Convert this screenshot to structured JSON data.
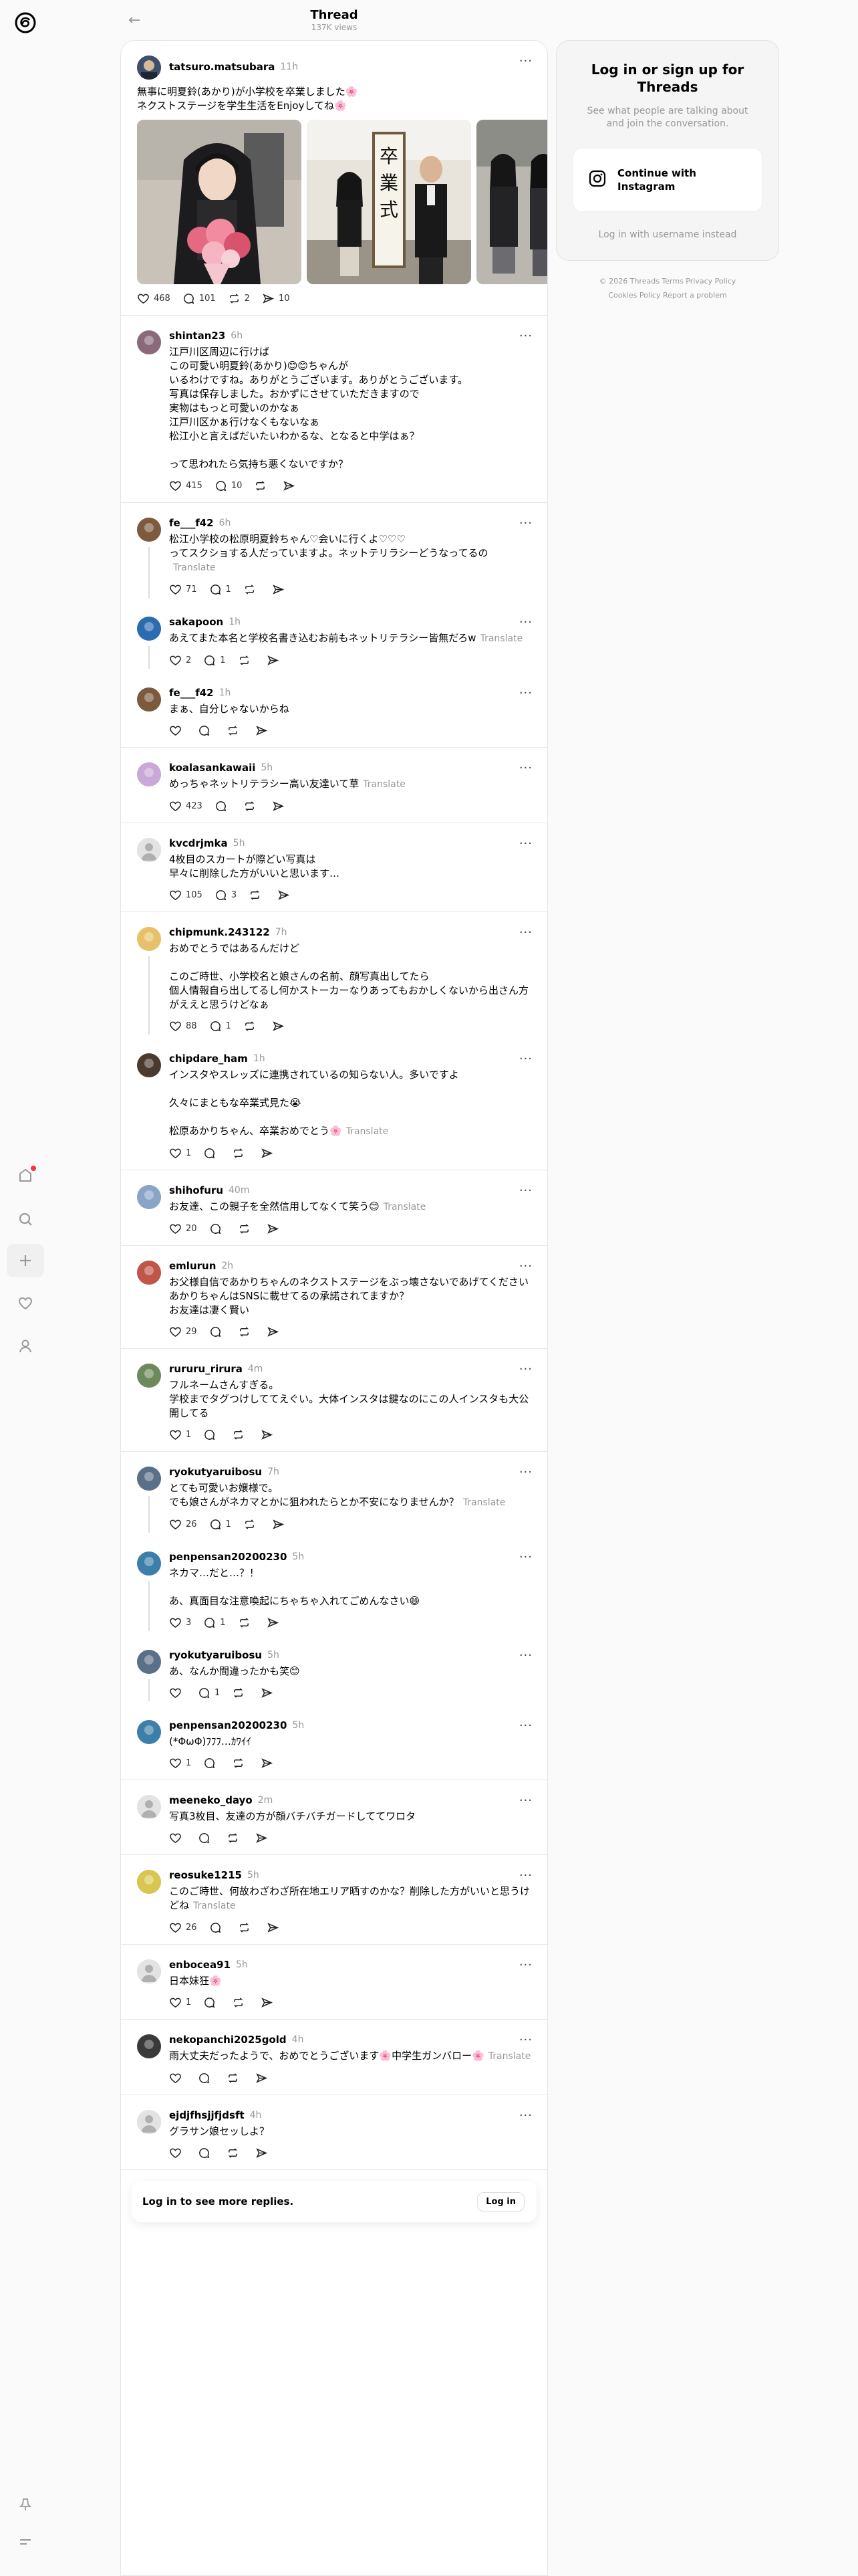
{
  "header": {
    "title": "Thread",
    "views": "137K views",
    "back_icon": "arrow-left-icon"
  },
  "main_post": {
    "username": "tatsuro.matsubara",
    "time": "11h",
    "text": "無事に明夏鈴(あかり)が小学校を卒業しました🌸\nネクストステージを学生生活をEnjoyしてね🌸",
    "likes": "468",
    "replies": "101",
    "reposts": "2",
    "shares": "10",
    "photos": [
      "graduation-photo-bouquet",
      "graduation-photo-sign",
      "graduation-photo-girls"
    ],
    "sign_text": "卒業式"
  },
  "replies": [
    {
      "id": "r1",
      "username": "shintan23",
      "time": "6h",
      "text": "江戸川区周辺に行けば\nこの可愛い明夏鈴(あかり)😊😊ちゃんが\nいるわけですね。ありがとうございます。ありがとうございます。\n写真は保存しました。おかずにさせていただきますので\n実物はもっと可愛いのかなぁ\n江戸川区かぁ行けなくもないなぁ\n松江小と言えばだいたいわかるな、となると中学はぁ？\n\nって思われたら気持ち悪くないですか？",
      "translate": "",
      "likes": "415",
      "replies": "10",
      "reposts": "",
      "shares": ""
    },
    {
      "id": "r2",
      "username": "fe___f42",
      "time": "6h",
      "text": "松江小学校の松原明夏鈴ちゃん♡会いに行くよ♡♡♡\nってスクショする人だっていますよ。ネットテリラシーどうなってるの",
      "translate": "Translate",
      "likes": "71",
      "replies": "1",
      "reposts": "",
      "shares": ""
    },
    {
      "id": "r3",
      "username": "sakapoon",
      "time": "1h",
      "text": "あえてまた本名と学校名書き込むお前もネットリテラシー皆無だろw",
      "translate": "Translate",
      "likes": "2",
      "replies": "1",
      "reposts": "",
      "shares": ""
    },
    {
      "id": "r4",
      "username": "fe___f42",
      "time": "1h",
      "text": "まぁ、自分じゃないからね",
      "translate": "",
      "likes": "",
      "replies": "",
      "reposts": "",
      "shares": ""
    },
    {
      "id": "r5",
      "username": "koalasankawaii",
      "time": "5h",
      "text": "めっちゃネットリテラシー高い友達いて草",
      "translate": "Translate",
      "likes": "423",
      "replies": "",
      "reposts": "",
      "shares": ""
    },
    {
      "id": "r6",
      "username": "kvcdrjmka",
      "time": "5h",
      "text": "4枚目のスカートが際どい写真は\n早々に削除した方がいいと思います…",
      "translate": "",
      "likes": "105",
      "replies": "3",
      "reposts": "",
      "shares": ""
    },
    {
      "id": "r7",
      "username": "chipmunk.243122",
      "time": "7h",
      "text": "おめでとうではあるんだけど\n\nこのご時世、小学校名と娘さんの名前、顔写真出してたら\n個人情報自ら出してるし何かストーカーなりあってもおかしくないから出さん方がええと思うけどなぁ",
      "translate": "",
      "likes": "88",
      "replies": "1",
      "reposts": "",
      "shares": ""
    },
    {
      "id": "r8",
      "username": "chipdare_ham",
      "time": "1h",
      "text": "インスタやスレッズに連携されているの知らない人。多いですよ\n\n久々にまともな卒業式見た😭\n\n松原あかりちゃん、卒業おめでとう🌸",
      "translate": "Translate",
      "likes": "1",
      "replies": "",
      "reposts": "",
      "shares": ""
    },
    {
      "id": "r9",
      "username": "shihofuru",
      "time": "40m",
      "text": "お友達、この親子を全然信用してなくて笑う😊",
      "translate": "Translate",
      "likes": "20",
      "replies": "",
      "reposts": "",
      "shares": ""
    },
    {
      "id": "r10",
      "username": "emlurun",
      "time": "2h",
      "text": "お父様自信であかりちゃんのネクストステージをぶっ壊さないであげてください\nあかりちゃんはSNSに載せてるの承諾されてますか？\nお友達は凄く賢い",
      "translate": "",
      "likes": "29",
      "replies": "",
      "reposts": "",
      "shares": ""
    },
    {
      "id": "r11",
      "username": "rururu_rirura",
      "time": "4m",
      "text": "フルネームさんすぎる。\n学校までタグつけしててえぐい。大体インスタは鍵なのにこの人インスタも大公開してる",
      "translate": "",
      "likes": "1",
      "replies": "",
      "reposts": "",
      "shares": ""
    },
    {
      "id": "r12",
      "username": "ryokutyaruibosu",
      "time": "7h",
      "text": "とても可愛いお嬢様で。\nでも娘さんがネカマとかに狙われたらとか不安になりませんか？",
      "translate": "Translate",
      "likes": "26",
      "replies": "1",
      "reposts": "",
      "shares": ""
    },
    {
      "id": "r13",
      "username": "penpensan20200230",
      "time": "5h",
      "text": "ネカマ…だと…？！\n\nあ、真面目な注意喚起にちゃちゃ入れてごめんなさい😄",
      "translate": "",
      "likes": "3",
      "replies": "1",
      "reposts": "",
      "shares": ""
    },
    {
      "id": "r14",
      "username": "ryokutyaruibosu",
      "time": "5h",
      "text": "あ、なんか間違ったかも笑😊",
      "translate": "",
      "likes": "",
      "replies": "1",
      "reposts": "",
      "shares": ""
    },
    {
      "id": "r15",
      "username": "penpensan20200230",
      "time": "5h",
      "text": "(*ΦωΦ)ﾌﾌﾌ…ｶﾜｲｲ",
      "translate": "",
      "likes": "1",
      "replies": "",
      "reposts": "",
      "shares": ""
    },
    {
      "id": "r16",
      "username": "meeneko_dayo",
      "time": "2m",
      "text": "写真3枚目、友達の方が顔バチバチガードしててワロタ",
      "translate": "",
      "likes": "",
      "replies": "",
      "reposts": "",
      "shares": ""
    },
    {
      "id": "r17",
      "username": "reosuke1215",
      "time": "5h",
      "text": "このご時世、何故わざわざ所在地エリア晒すのかな？削除した方がいいと思うけどね",
      "translate": "Translate",
      "likes": "26",
      "replies": "",
      "reposts": "",
      "shares": ""
    },
    {
      "id": "r18",
      "username": "enbocea91",
      "time": "5h",
      "text": "日本妹狂🌸",
      "translate": "",
      "likes": "1",
      "replies": "",
      "reposts": "",
      "shares": ""
    },
    {
      "id": "r19",
      "username": "nekopanchi2025gold",
      "time": "4h",
      "text": "雨大丈夫だったようで、おめでとうございます🌸中学生ガンバロー🌸",
      "translate": "Translate",
      "likes": "",
      "replies": "",
      "reposts": "",
      "shares": ""
    },
    {
      "id": "r20",
      "username": "ejdjfhsjjfjdsft",
      "time": "4h",
      "text": "グラサン娘セッしよ？",
      "translate": "",
      "likes": "",
      "replies": "",
      "reposts": "",
      "shares": ""
    }
  ],
  "banner": {
    "text": "Log in to see more replies.",
    "button": "Log in"
  },
  "sidebar_card": {
    "title": "Log in or sign up for Threads",
    "subtitle": "See what people are talking about and join the conversation.",
    "instagram_button": "Continue with Instagram",
    "alt_link": "Log in with username instead"
  },
  "footer": {
    "line1": "© 2026   Threads Terms   Privacy Policy",
    "line2": "Cookies Policy   Report a problem"
  },
  "more_label": "···",
  "icons": [
    "threads-logo-icon",
    "home-icon",
    "search-icon",
    "create-icon",
    "heart-icon",
    "profile-icon",
    "pin-icon",
    "menu-icon",
    "instagram-icon",
    "like-icon",
    "reply-icon",
    "repost-icon",
    "share-icon"
  ]
}
